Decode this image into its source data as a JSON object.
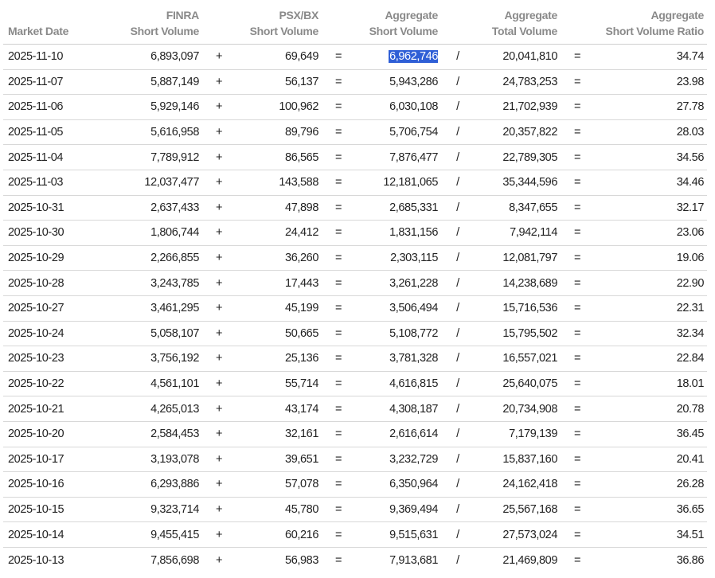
{
  "header": {
    "date": "Market Date",
    "finra": [
      "FINRA",
      "Short Volume"
    ],
    "psx": [
      "PSX/BX",
      "Short Volume"
    ],
    "agg": [
      "Aggregate",
      "Short Volume"
    ],
    "total": [
      "Aggregate",
      "Total Volume"
    ],
    "ratio": [
      "Aggregate",
      "Short Volume Ratio"
    ]
  },
  "operators": {
    "plus": "+",
    "eq": "=",
    "div": "/"
  },
  "colors": {
    "highlight": "#2f5fd6",
    "header_text": "#8a8a8a",
    "row_border": "#d8d8d8"
  },
  "rows": [
    {
      "date": "2025-11-10",
      "finra": "6,893,097",
      "psx": "69,649",
      "agg": "6,962,746",
      "total": "20,041,810",
      "ratio": "34.74",
      "selected": true
    },
    {
      "date": "2025-11-07",
      "finra": "5,887,149",
      "psx": "56,137",
      "agg": "5,943,286",
      "total": "24,783,253",
      "ratio": "23.98"
    },
    {
      "date": "2025-11-06",
      "finra": "5,929,146",
      "psx": "100,962",
      "agg": "6,030,108",
      "total": "21,702,939",
      "ratio": "27.78"
    },
    {
      "date": "2025-11-05",
      "finra": "5,616,958",
      "psx": "89,796",
      "agg": "5,706,754",
      "total": "20,357,822",
      "ratio": "28.03"
    },
    {
      "date": "2025-11-04",
      "finra": "7,789,912",
      "psx": "86,565",
      "agg": "7,876,477",
      "total": "22,789,305",
      "ratio": "34.56"
    },
    {
      "date": "2025-11-03",
      "finra": "12,037,477",
      "psx": "143,588",
      "agg": "12,181,065",
      "total": "35,344,596",
      "ratio": "34.46"
    },
    {
      "date": "2025-10-31",
      "finra": "2,637,433",
      "psx": "47,898",
      "agg": "2,685,331",
      "total": "8,347,655",
      "ratio": "32.17"
    },
    {
      "date": "2025-10-30",
      "finra": "1,806,744",
      "psx": "24,412",
      "agg": "1,831,156",
      "total": "7,942,114",
      "ratio": "23.06"
    },
    {
      "date": "2025-10-29",
      "finra": "2,266,855",
      "psx": "36,260",
      "agg": "2,303,115",
      "total": "12,081,797",
      "ratio": "19.06"
    },
    {
      "date": "2025-10-28",
      "finra": "3,243,785",
      "psx": "17,443",
      "agg": "3,261,228",
      "total": "14,238,689",
      "ratio": "22.90"
    },
    {
      "date": "2025-10-27",
      "finra": "3,461,295",
      "psx": "45,199",
      "agg": "3,506,494",
      "total": "15,716,536",
      "ratio": "22.31"
    },
    {
      "date": "2025-10-24",
      "finra": "5,058,107",
      "psx": "50,665",
      "agg": "5,108,772",
      "total": "15,795,502",
      "ratio": "32.34"
    },
    {
      "date": "2025-10-23",
      "finra": "3,756,192",
      "psx": "25,136",
      "agg": "3,781,328",
      "total": "16,557,021",
      "ratio": "22.84"
    },
    {
      "date": "2025-10-22",
      "finra": "4,561,101",
      "psx": "55,714",
      "agg": "4,616,815",
      "total": "25,640,075",
      "ratio": "18.01"
    },
    {
      "date": "2025-10-21",
      "finra": "4,265,013",
      "psx": "43,174",
      "agg": "4,308,187",
      "total": "20,734,908",
      "ratio": "20.78"
    },
    {
      "date": "2025-10-20",
      "finra": "2,584,453",
      "psx": "32,161",
      "agg": "2,616,614",
      "total": "7,179,139",
      "ratio": "36.45"
    },
    {
      "date": "2025-10-17",
      "finra": "3,193,078",
      "psx": "39,651",
      "agg": "3,232,729",
      "total": "15,837,160",
      "ratio": "20.41"
    },
    {
      "date": "2025-10-16",
      "finra": "6,293,886",
      "psx": "57,078",
      "agg": "6,350,964",
      "total": "24,162,418",
      "ratio": "26.28"
    },
    {
      "date": "2025-10-15",
      "finra": "9,323,714",
      "psx": "45,780",
      "agg": "9,369,494",
      "total": "25,567,168",
      "ratio": "36.65"
    },
    {
      "date": "2025-10-14",
      "finra": "9,455,415",
      "psx": "60,216",
      "agg": "9,515,631",
      "total": "27,573,024",
      "ratio": "34.51"
    },
    {
      "date": "2025-10-13",
      "finra": "7,856,698",
      "psx": "56,983",
      "agg": "7,913,681",
      "total": "21,469,809",
      "ratio": "36.86"
    }
  ]
}
